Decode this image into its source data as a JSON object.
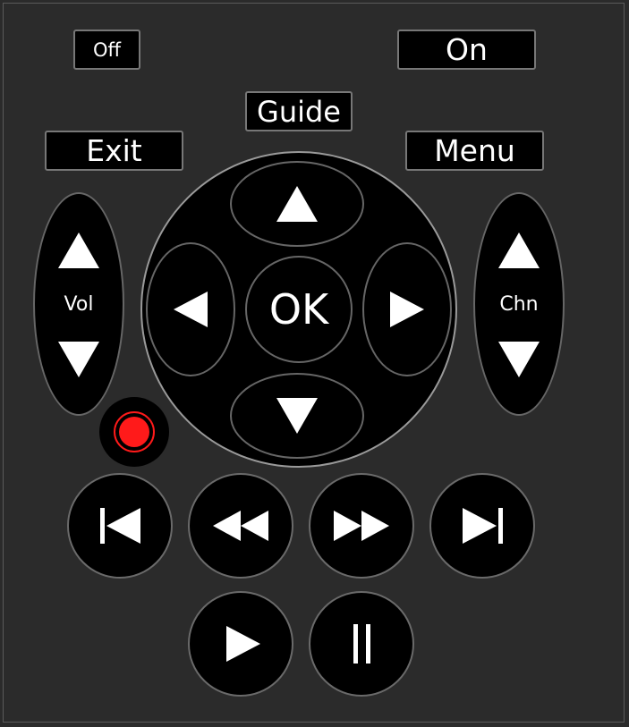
{
  "remote": {
    "off_label": "Off",
    "on_label": "On",
    "guide_label": "Guide",
    "exit_label": "Exit",
    "menu_label": "Menu",
    "ok_label": "OK",
    "vol_label": "Vol",
    "chn_label": "Chn"
  },
  "colors": {
    "background": "#2b2b2b",
    "button": "#000000",
    "record": "#ff1a1a"
  },
  "icons": {
    "dpad_up": "triangle-up-icon",
    "dpad_down": "triangle-down-icon",
    "dpad_left": "triangle-left-icon",
    "dpad_right": "triangle-right-icon",
    "record": "record-icon",
    "skip_back": "skip-back-icon",
    "rewind": "rewind-icon",
    "fast_forward": "fast-forward-icon",
    "skip_forward": "skip-forward-icon",
    "play": "play-icon",
    "pause": "pause-icon"
  }
}
